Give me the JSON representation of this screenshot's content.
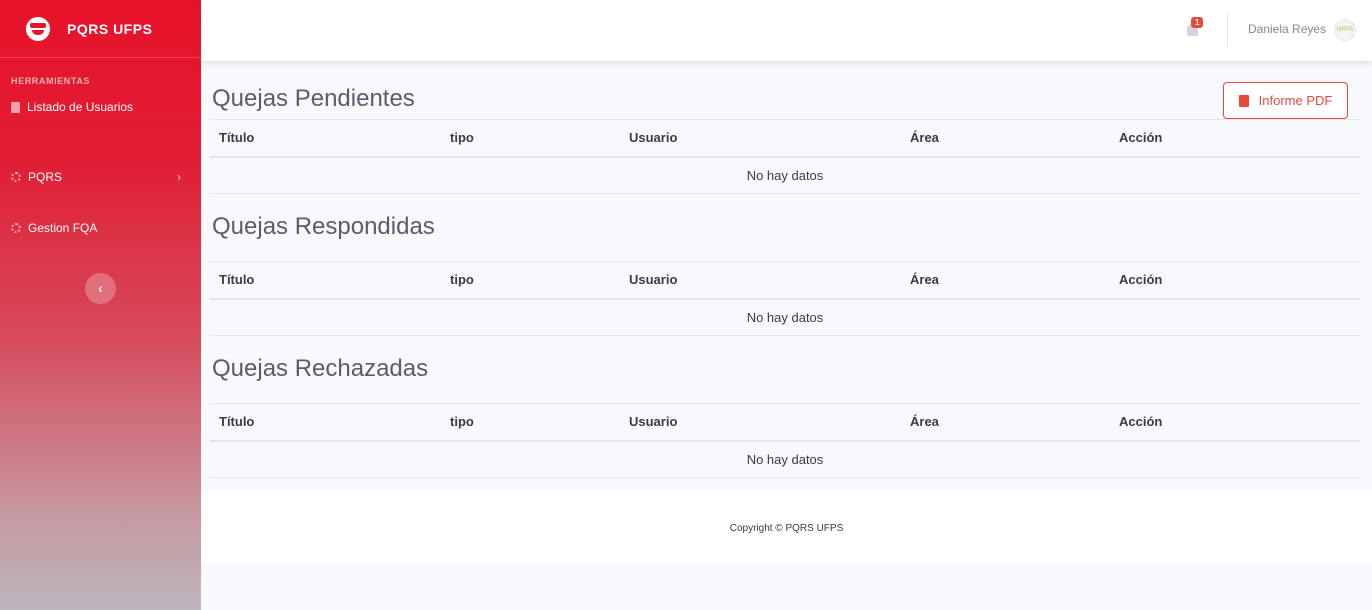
{
  "sidebar": {
    "brand": "PQRS UFPS",
    "section_heading": "HERRAMIENTAS",
    "items": [
      {
        "label": "Listado de Usuarios",
        "icon": "document-icon"
      },
      {
        "label": "PQRS",
        "icon": "cog-icon"
      },
      {
        "label": "Gestion FQA",
        "icon": "cog-icon"
      }
    ],
    "toggle_glyph": "‹"
  },
  "topbar": {
    "alerts_count": "1",
    "user_name": "Daniela Reyes"
  },
  "main": {
    "pdf_button": "Informe PDF",
    "columns": [
      "Título",
      "tipo",
      "Usuario",
      "Área",
      "Acción"
    ],
    "sections": [
      {
        "title": "Quejas Pendientes",
        "empty_text": "No hay datos"
      },
      {
        "title": "Quejas Respondidas",
        "empty_text": "No hay datos"
      },
      {
        "title": "Quejas Rechazadas",
        "empty_text": "No hay datos"
      }
    ]
  },
  "footer": {
    "copyright": "Copyright © PQRS UFPS"
  },
  "colors": {
    "brand_red": "#e8132a",
    "danger": "#e74a3b"
  }
}
